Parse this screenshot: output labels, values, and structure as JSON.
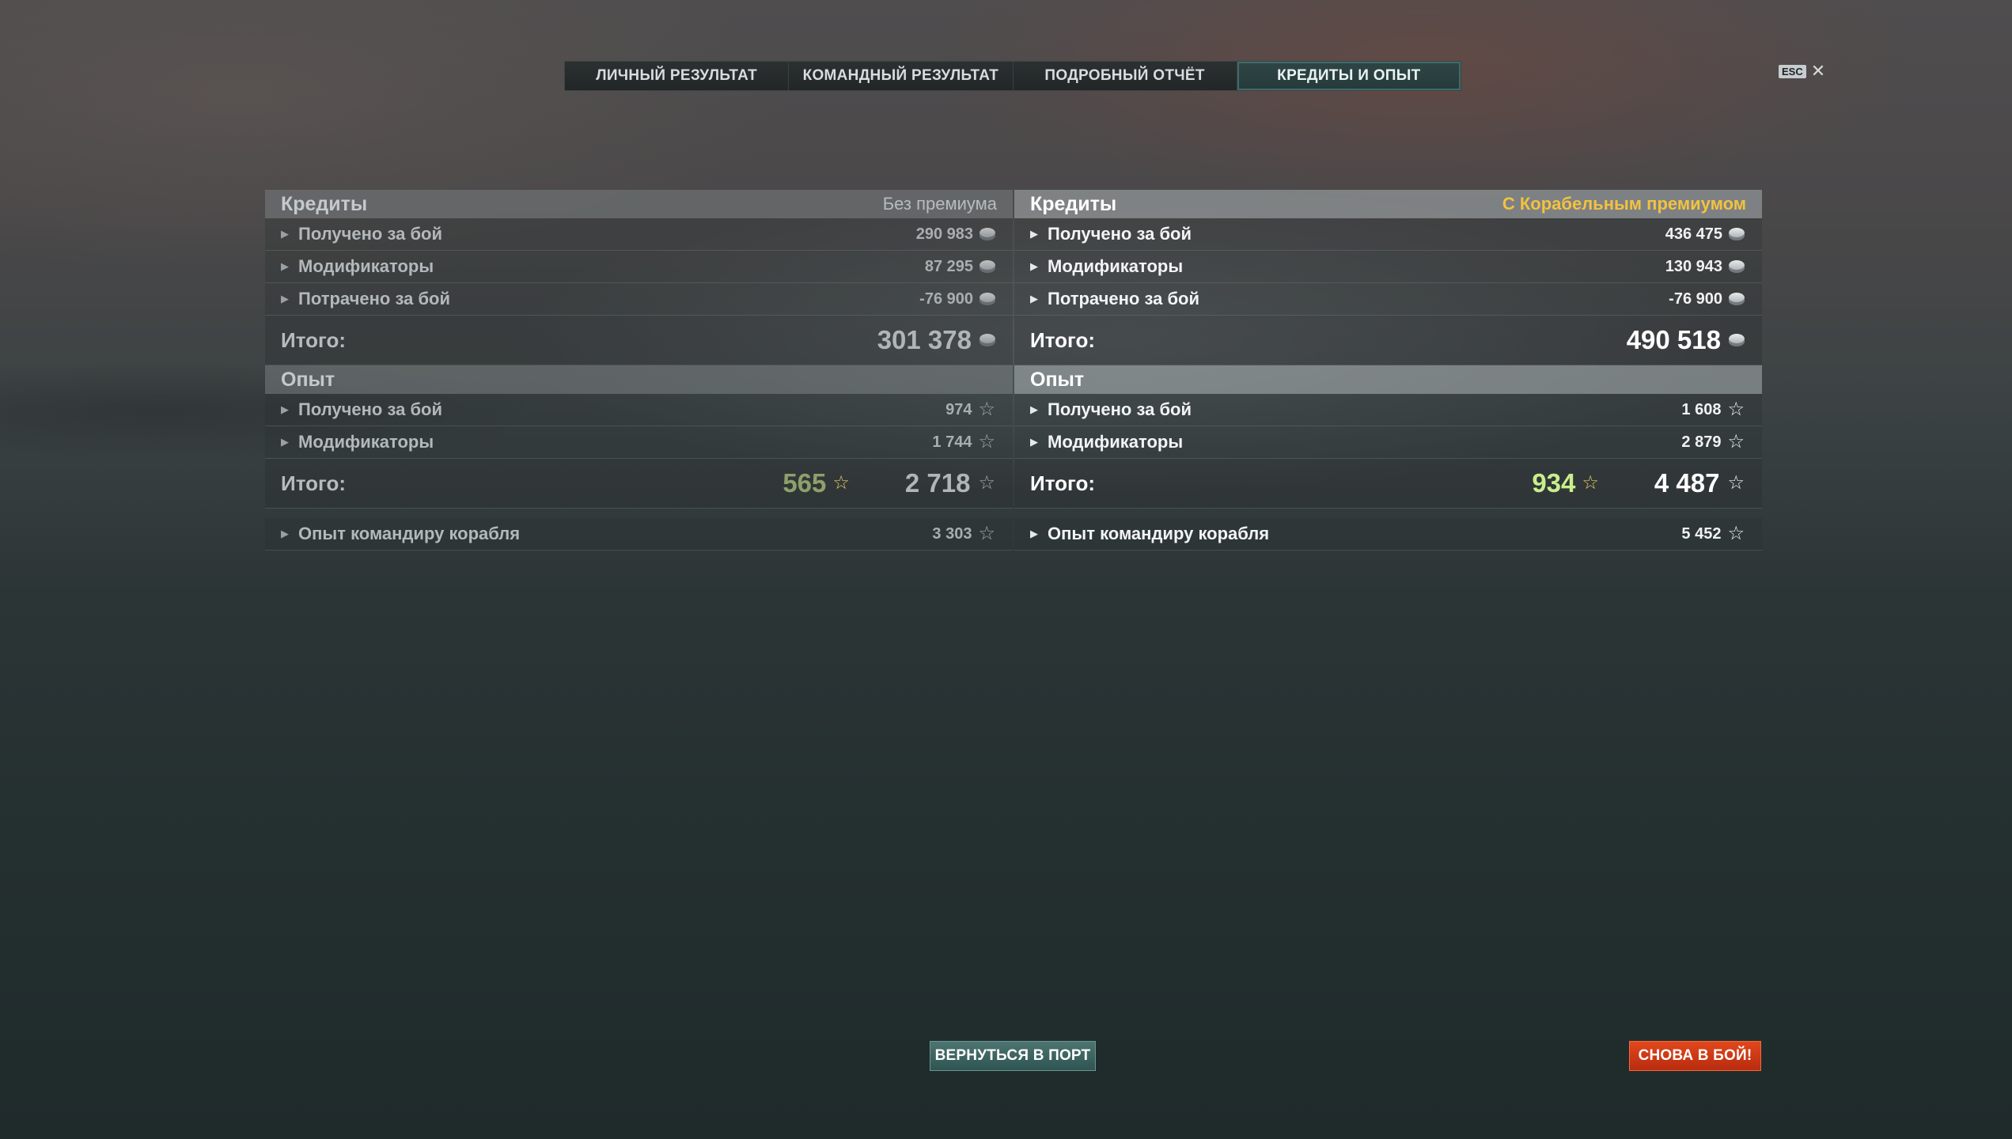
{
  "tabs": [
    {
      "label": "ЛИЧНЫЙ РЕЗУЛЬТАТ"
    },
    {
      "label": "КОМАНДНЫЙ РЕЗУЛЬТАТ"
    },
    {
      "label": "ПОДРОБНЫЙ ОТЧЁТ"
    },
    {
      "label": "КРЕДИТЫ И ОПЫТ",
      "active": true
    }
  ],
  "esc": {
    "badge": "ESC",
    "close": "✕"
  },
  "left": {
    "credits": {
      "title": "Кредиты",
      "tag": "Без премиума",
      "rows": [
        {
          "label": "Получено за бой",
          "value": "290 983"
        },
        {
          "label": "Модификаторы",
          "value": "87 295"
        },
        {
          "label": "Потрачено за бой",
          "value": "-76 900"
        }
      ],
      "total_label": "Итого:",
      "total_value": "301 378"
    },
    "xp": {
      "title": "Опыт",
      "rows": [
        {
          "label": "Получено за бой",
          "value": "974"
        },
        {
          "label": "Модификаторы",
          "value": "1 744"
        }
      ],
      "total_label": "Итого:",
      "premium_value": "565",
      "total_value": "2 718"
    },
    "commander": {
      "label": "Опыт командиру корабля",
      "value": "3 303"
    }
  },
  "right": {
    "credits": {
      "title": "Кредиты",
      "tag": "С Корабельным премиумом",
      "rows": [
        {
          "label": "Получено за бой",
          "value": "436 475"
        },
        {
          "label": "Модификаторы",
          "value": "130 943"
        },
        {
          "label": "Потрачено за бой",
          "value": "-76 900"
        }
      ],
      "total_label": "Итого:",
      "total_value": "490 518"
    },
    "xp": {
      "title": "Опыт",
      "rows": [
        {
          "label": "Получено за бой",
          "value": "1 608"
        },
        {
          "label": "Модификаторы",
          "value": "2 879"
        }
      ],
      "total_label": "Итого:",
      "premium_value": "934",
      "total_value": "4 487"
    },
    "commander": {
      "label": "Опыт командиру корабля",
      "value": "5 452"
    }
  },
  "buttons": {
    "port": "ВЕРНУТЬСЯ В ПОРТ",
    "battle": "СНОВА В БОЙ!"
  },
  "icons": {
    "expand": "triangle-right-icon",
    "credits": "coin-icon",
    "xp": "star-icon"
  },
  "colors": {
    "premium_tag": "#f2c240",
    "premium_xp": "#c8ef8c",
    "battle_button": "#d23b17",
    "port_button": "#3e6663"
  }
}
